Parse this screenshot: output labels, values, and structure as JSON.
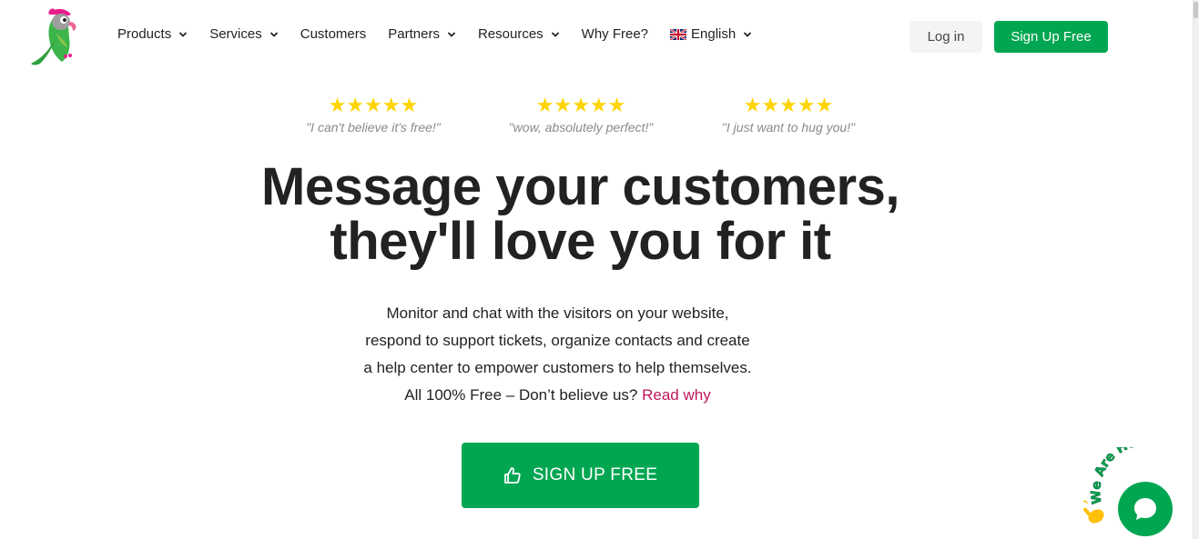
{
  "header": {
    "nav": [
      {
        "label": "Products",
        "dropdown": true,
        "name": "nav-products"
      },
      {
        "label": "Services",
        "dropdown": true,
        "name": "nav-services"
      },
      {
        "label": "Customers",
        "dropdown": false,
        "name": "nav-customers"
      },
      {
        "label": "Partners",
        "dropdown": true,
        "name": "nav-partners"
      },
      {
        "label": "Resources",
        "dropdown": true,
        "name": "nav-resources"
      },
      {
        "label": "Why Free?",
        "dropdown": false,
        "name": "nav-why-free"
      }
    ],
    "language": "English",
    "login_label": "Log in",
    "signup_label": "Sign Up Free"
  },
  "reviews": [
    {
      "stars": "★★★★★",
      "quote": "\"I can't believe it's free!\""
    },
    {
      "stars": "★★★★★",
      "quote": "\"wow, absolutely perfect!\""
    },
    {
      "stars": "★★★★★",
      "quote": "\"I just want to hug you!\""
    }
  ],
  "hero": {
    "headline_line1": "Message your customers,",
    "headline_line2": "they'll love you for it",
    "sub_line1": "Monitor and chat with the visitors on your website,",
    "sub_line2": "respond to support tickets, organize contacts and create",
    "sub_line3": "a help center to empower customers to help themselves.",
    "sub_line4_prefix": "All 100% Free – Don’t believe us? ",
    "sub_line4_link": "Read why",
    "cta_label": "SIGN UP FREE"
  },
  "chat_widget": {
    "badge_text": "We Are Here!",
    "icon": "chat-bubble-icon"
  },
  "colors": {
    "brand_green": "#00a651",
    "star_yellow": "#ffd400",
    "link_pink": "#c2185b"
  }
}
